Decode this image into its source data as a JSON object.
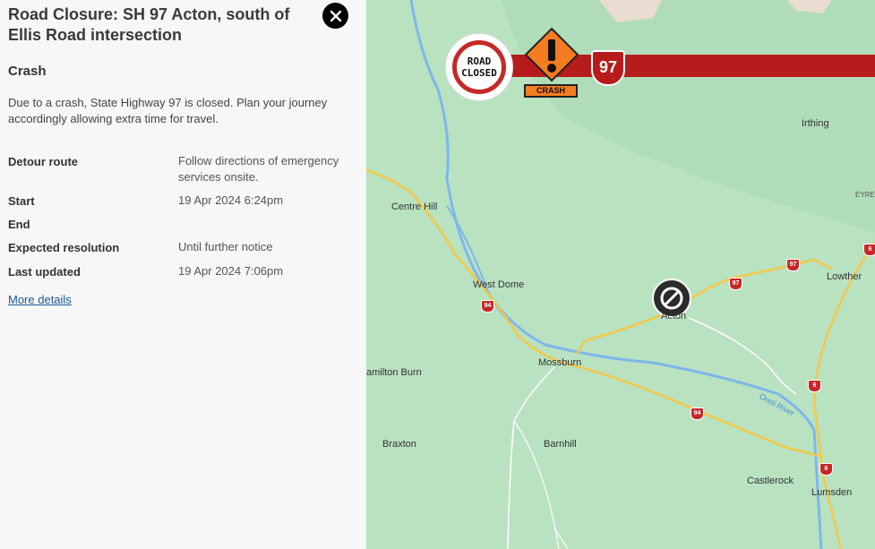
{
  "panel": {
    "title": "Road Closure: SH 97 Acton, south of Ellis Road intersection",
    "category": "Crash",
    "description": "Due to a crash, State Highway 97 is closed. Plan your journey accordingly allowing extra time for travel.",
    "rows": [
      {
        "label": "Detour route",
        "value": "Follow directions of emergency services onsite."
      },
      {
        "label": "Start",
        "value": "19 Apr 2024 6:24pm"
      },
      {
        "label": "End",
        "value": ""
      },
      {
        "label": "Expected resolution",
        "value": "Until further notice"
      },
      {
        "label": "Last updated",
        "value": "19 Apr 2024 7:06pm"
      }
    ],
    "more_link": "More details",
    "close_icon": "close-icon"
  },
  "banner": {
    "road_closed_line1": "ROAD",
    "road_closed_line2": "CLOSED",
    "crash_label": "CRASH",
    "highway_number": "97",
    "bar_color": "#b71c1c",
    "sign_color": "#f57c20"
  },
  "map": {
    "places": [
      "Irthing",
      "EYRE",
      "Centre Hill",
      "West Dome",
      "Acton",
      "Lowther",
      "Mossburn",
      "amilton Burn",
      "Braxton",
      "Barnhill",
      "Castlerock",
      "Lumsden"
    ],
    "river_label": "Oreti River",
    "shields": [
      "97",
      "97",
      "94",
      "94",
      "6",
      "6",
      "6"
    ],
    "closure_icon": "no-entry-icon",
    "colors": {
      "land": "#b9e2c1",
      "road": "#f2c94c",
      "river": "#7fb6ea"
    }
  }
}
